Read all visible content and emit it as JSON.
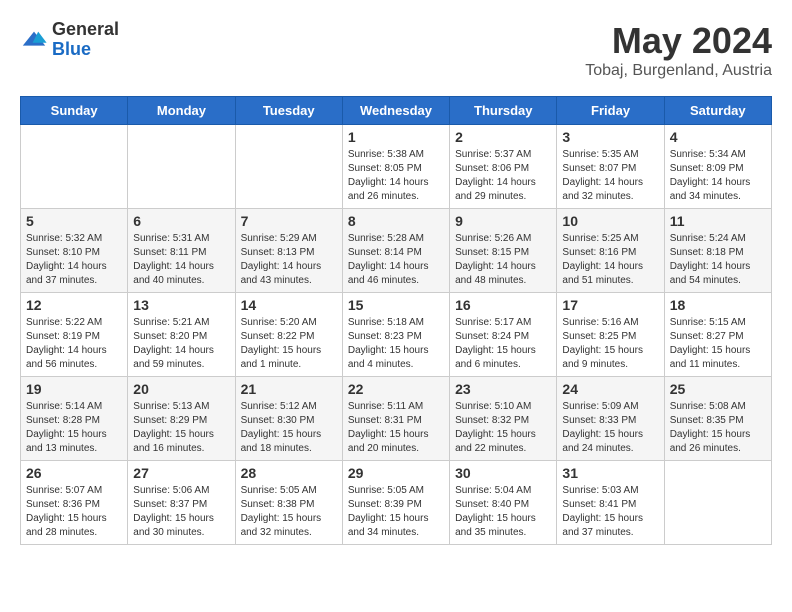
{
  "header": {
    "logo_general": "General",
    "logo_blue": "Blue",
    "title": "May 2024",
    "subtitle": "Tobaj, Burgenland, Austria"
  },
  "days_of_week": [
    "Sunday",
    "Monday",
    "Tuesday",
    "Wednesday",
    "Thursday",
    "Friday",
    "Saturday"
  ],
  "weeks": [
    {
      "shaded": false,
      "cells": [
        {
          "day": "",
          "info": ""
        },
        {
          "day": "",
          "info": ""
        },
        {
          "day": "",
          "info": ""
        },
        {
          "day": "1",
          "info": "Sunrise: 5:38 AM\nSunset: 8:05 PM\nDaylight: 14 hours\nand 26 minutes."
        },
        {
          "day": "2",
          "info": "Sunrise: 5:37 AM\nSunset: 8:06 PM\nDaylight: 14 hours\nand 29 minutes."
        },
        {
          "day": "3",
          "info": "Sunrise: 5:35 AM\nSunset: 8:07 PM\nDaylight: 14 hours\nand 32 minutes."
        },
        {
          "day": "4",
          "info": "Sunrise: 5:34 AM\nSunset: 8:09 PM\nDaylight: 14 hours\nand 34 minutes."
        }
      ]
    },
    {
      "shaded": true,
      "cells": [
        {
          "day": "5",
          "info": "Sunrise: 5:32 AM\nSunset: 8:10 PM\nDaylight: 14 hours\nand 37 minutes."
        },
        {
          "day": "6",
          "info": "Sunrise: 5:31 AM\nSunset: 8:11 PM\nDaylight: 14 hours\nand 40 minutes."
        },
        {
          "day": "7",
          "info": "Sunrise: 5:29 AM\nSunset: 8:13 PM\nDaylight: 14 hours\nand 43 minutes."
        },
        {
          "day": "8",
          "info": "Sunrise: 5:28 AM\nSunset: 8:14 PM\nDaylight: 14 hours\nand 46 minutes."
        },
        {
          "day": "9",
          "info": "Sunrise: 5:26 AM\nSunset: 8:15 PM\nDaylight: 14 hours\nand 48 minutes."
        },
        {
          "day": "10",
          "info": "Sunrise: 5:25 AM\nSunset: 8:16 PM\nDaylight: 14 hours\nand 51 minutes."
        },
        {
          "day": "11",
          "info": "Sunrise: 5:24 AM\nSunset: 8:18 PM\nDaylight: 14 hours\nand 54 minutes."
        }
      ]
    },
    {
      "shaded": false,
      "cells": [
        {
          "day": "12",
          "info": "Sunrise: 5:22 AM\nSunset: 8:19 PM\nDaylight: 14 hours\nand 56 minutes."
        },
        {
          "day": "13",
          "info": "Sunrise: 5:21 AM\nSunset: 8:20 PM\nDaylight: 14 hours\nand 59 minutes."
        },
        {
          "day": "14",
          "info": "Sunrise: 5:20 AM\nSunset: 8:22 PM\nDaylight: 15 hours\nand 1 minute."
        },
        {
          "day": "15",
          "info": "Sunrise: 5:18 AM\nSunset: 8:23 PM\nDaylight: 15 hours\nand 4 minutes."
        },
        {
          "day": "16",
          "info": "Sunrise: 5:17 AM\nSunset: 8:24 PM\nDaylight: 15 hours\nand 6 minutes."
        },
        {
          "day": "17",
          "info": "Sunrise: 5:16 AM\nSunset: 8:25 PM\nDaylight: 15 hours\nand 9 minutes."
        },
        {
          "day": "18",
          "info": "Sunrise: 5:15 AM\nSunset: 8:27 PM\nDaylight: 15 hours\nand 11 minutes."
        }
      ]
    },
    {
      "shaded": true,
      "cells": [
        {
          "day": "19",
          "info": "Sunrise: 5:14 AM\nSunset: 8:28 PM\nDaylight: 15 hours\nand 13 minutes."
        },
        {
          "day": "20",
          "info": "Sunrise: 5:13 AM\nSunset: 8:29 PM\nDaylight: 15 hours\nand 16 minutes."
        },
        {
          "day": "21",
          "info": "Sunrise: 5:12 AM\nSunset: 8:30 PM\nDaylight: 15 hours\nand 18 minutes."
        },
        {
          "day": "22",
          "info": "Sunrise: 5:11 AM\nSunset: 8:31 PM\nDaylight: 15 hours\nand 20 minutes."
        },
        {
          "day": "23",
          "info": "Sunrise: 5:10 AM\nSunset: 8:32 PM\nDaylight: 15 hours\nand 22 minutes."
        },
        {
          "day": "24",
          "info": "Sunrise: 5:09 AM\nSunset: 8:33 PM\nDaylight: 15 hours\nand 24 minutes."
        },
        {
          "day": "25",
          "info": "Sunrise: 5:08 AM\nSunset: 8:35 PM\nDaylight: 15 hours\nand 26 minutes."
        }
      ]
    },
    {
      "shaded": false,
      "cells": [
        {
          "day": "26",
          "info": "Sunrise: 5:07 AM\nSunset: 8:36 PM\nDaylight: 15 hours\nand 28 minutes."
        },
        {
          "day": "27",
          "info": "Sunrise: 5:06 AM\nSunset: 8:37 PM\nDaylight: 15 hours\nand 30 minutes."
        },
        {
          "day": "28",
          "info": "Sunrise: 5:05 AM\nSunset: 8:38 PM\nDaylight: 15 hours\nand 32 minutes."
        },
        {
          "day": "29",
          "info": "Sunrise: 5:05 AM\nSunset: 8:39 PM\nDaylight: 15 hours\nand 34 minutes."
        },
        {
          "day": "30",
          "info": "Sunrise: 5:04 AM\nSunset: 8:40 PM\nDaylight: 15 hours\nand 35 minutes."
        },
        {
          "day": "31",
          "info": "Sunrise: 5:03 AM\nSunset: 8:41 PM\nDaylight: 15 hours\nand 37 minutes."
        },
        {
          "day": "",
          "info": ""
        }
      ]
    }
  ]
}
